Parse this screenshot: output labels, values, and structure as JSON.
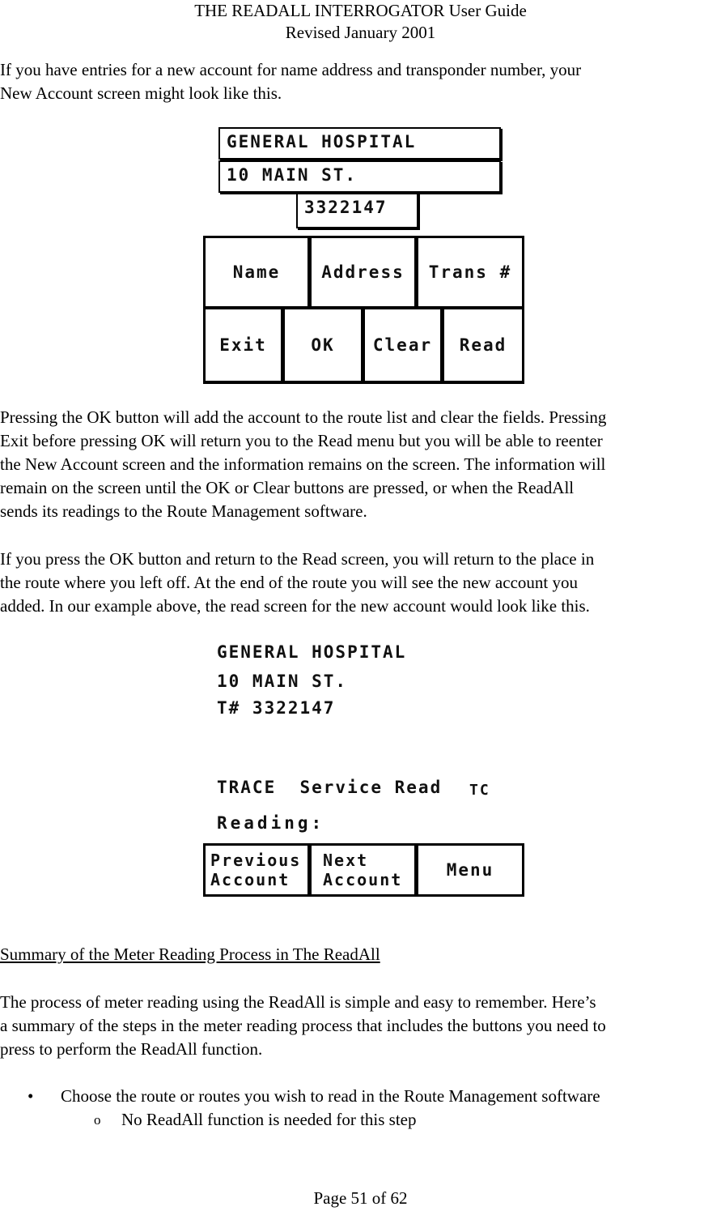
{
  "header": {
    "title": "THE READALL INTERROGATOR User Guide",
    "revised": "Revised January 2001"
  },
  "intro_paragraph": "If you have entries for a new account for name address and transponder number, your\nNew Account screen might look like this.",
  "new_account_screen": {
    "name_field": "GENERAL HOSPITAL",
    "address_field": "10 MAIN ST.",
    "transponder_field": "3322147",
    "buttons_row1": [
      "Name",
      "Address",
      "Trans #"
    ],
    "buttons_row2": [
      "Exit",
      "OK",
      "Clear",
      "Read"
    ]
  },
  "paragraph_ok": "Pressing the OK button will add the account to the route list and clear the fields.  Pressing\nExit before pressing OK will return you to the Read menu but you will be able to reenter\nthe New Account screen and the information remains on the screen.  The information will\nremain on the screen until the OK or Clear buttons are pressed, or when the ReadAll\nsends its readings to the Route Management software.",
  "paragraph_return": "If you press the OK button and return to the Read screen, you will return to the place in\nthe route where you left off.  At the end of the route you will see the new account you\nadded.  In our example above, the read screen for the new account would look like this.",
  "read_screen": {
    "name_line": "GENERAL HOSPITAL",
    "address_line": "10 MAIN ST.",
    "transponder_line": "T# 3322147",
    "status_line": "TRACE  Service Read",
    "status_code": "TC",
    "reading_label": "Reading:",
    "buttons": [
      {
        "line1": "Previous",
        "line2": "Account"
      },
      {
        "line1": "Next",
        "line2": "Account"
      },
      {
        "line1": "Menu",
        "line2": ""
      }
    ]
  },
  "summary": {
    "heading": "Summary of the Meter Reading Process in The ReadAll",
    "paragraph": "The process of meter reading using the ReadAll is simple and easy to remember.  Here’s\na summary of the steps in the meter reading process that includes the buttons you need to\npress to perform the ReadAll function.",
    "bullets": [
      {
        "text": "Choose the route or routes you wish to read in the Route Management software",
        "sub": [
          "No ReadAll function is needed for this step"
        ]
      }
    ]
  },
  "footer": {
    "page": "Page 51 of 62"
  }
}
